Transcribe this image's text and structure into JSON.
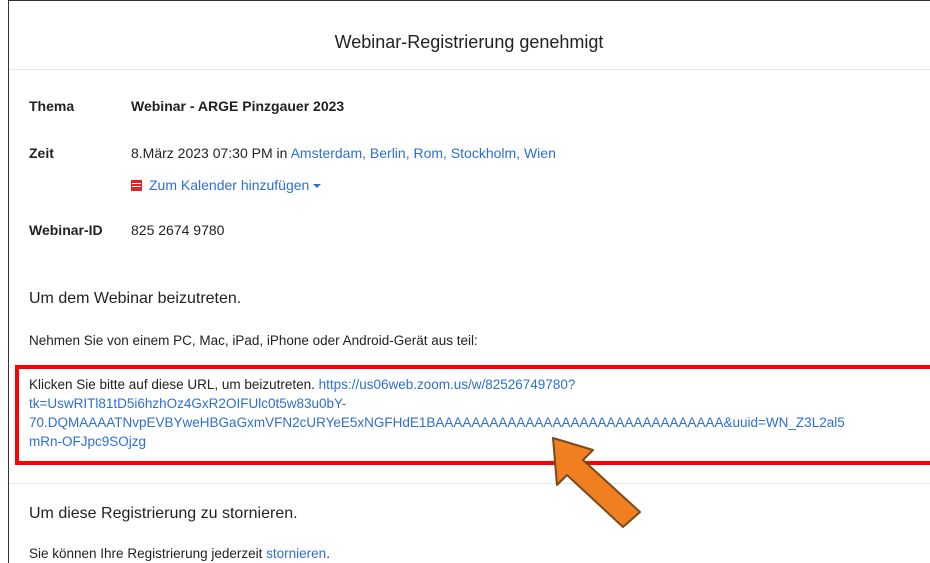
{
  "header": {
    "title": "Webinar-Registrierung genehmigt"
  },
  "details": {
    "topic_label": "Thema",
    "topic_value": "Webinar - ARGE Pinzgauer 2023",
    "time_label": "Zeit",
    "time_value": "8.März 2023 07:30 PM",
    "time_in": "in",
    "timezone": "Amsterdam, Berlin, Rom, Stockholm, Wien",
    "calendar_link": "Zum Kalender hinzufügen",
    "id_label": "Webinar-ID",
    "id_value": "825 2674 9780"
  },
  "join": {
    "heading": "Um dem Webinar beizutreten.",
    "devices_text": "Nehmen Sie von einem PC, Mac, iPad, iPhone oder Android-Gerät aus teil:",
    "url_prefix": "Klicken Sie bitte auf diese URL, um beizutreten.",
    "url_line1": "https://us06web.zoom.us/w/82526749780?",
    "url_line2": "tk=UswRITl81tD5i6hzhOz4GxR2OIFUlc0t5w83u0bY-",
    "url_line3": "70.DQMAAAATNvpEVBYweHBGaGxmVFN2cURYeE5xNGFHdE1BAAAAAAAAAAAAAAAAAAAAAAAAAAAAAAAA&uuid=WN_Z3L2al5",
    "url_line4": "mRn-OFJpc9SOjzg"
  },
  "cancel": {
    "heading": "Um diese Registrierung zu stornieren.",
    "text": "Sie können Ihre Registrierung jederzeit",
    "link": "stornieren",
    "suffix": "."
  },
  "colors": {
    "link": "#2d6fd0",
    "highlight_box": "#ff0000",
    "arrow": "#f07f22"
  }
}
